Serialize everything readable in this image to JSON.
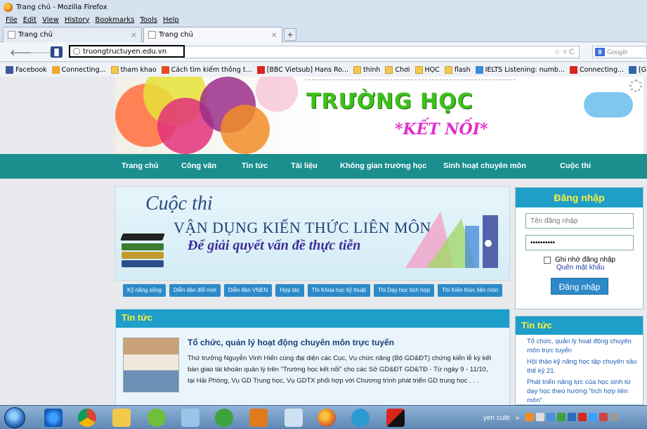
{
  "window": {
    "title": "Trang chủ - Mozilla Firefox"
  },
  "menu": [
    "File",
    "Edit",
    "View",
    "History",
    "Bookmarks",
    "Tools",
    "Help"
  ],
  "tabs": [
    {
      "label": "Trang chủ",
      "close": "×"
    },
    {
      "label": "Trang chủ",
      "close": "×"
    }
  ],
  "new_tab": "+",
  "nav": {
    "back": "🡐",
    "forward": "🡒",
    "url": "truongtructuyen.edu.vn",
    "search_placeholder": "Google",
    "search_engine": "8"
  },
  "bookmarks": [
    {
      "label": "Facebook",
      "icon": "facebook-icon"
    },
    {
      "label": "Connecting...",
      "icon": "connecting-icon"
    },
    {
      "label": "tham khao",
      "icon": "folder-icon"
    },
    {
      "label": "Cách tìm kiếm thông t...",
      "icon": "p-icon"
    },
    {
      "label": "[BBC Vietsub] Hans Ro...",
      "icon": "youtube-icon"
    },
    {
      "label": "thinh",
      "icon": "folder-icon"
    },
    {
      "label": "Chơi",
      "icon": "folder-icon"
    },
    {
      "label": "HỌC",
      "icon": "folder-icon"
    },
    {
      "label": "flash",
      "icon": "folder-icon"
    },
    {
      "label": "IELTS Listening: numb...",
      "icon": "ielts-icon"
    },
    {
      "label": "Connecting...",
      "icon": "youtube-icon"
    },
    {
      "label": "[Giải quyết] [Xóa",
      "icon": "globe-icon"
    }
  ],
  "banner": {
    "title": "TRƯỜNG HỌC",
    "subtitle": "*KẾT NỐI*"
  },
  "main_nav": [
    "Trang chủ",
    "Công văn",
    "Tin tức",
    "Tài liệu",
    "Không gian trường học",
    "Sinh hoạt chuyên môn",
    "Cuộc thi"
  ],
  "contest": {
    "title": "Cuộc thi",
    "line1": "VẬN DỤNG KIẾN THỨC LIÊN MÔN",
    "line2": "Để giải quyết vấn đề thực tiễn"
  },
  "categories": [
    "Kỹ năng sống",
    "Diễn đàn đổi mới",
    "Diễn đàn VNEN",
    "Hợp tác",
    "Thi Khoa học kỹ thuật",
    "Thi Dạy học tích hợp",
    "Thi Kiến thức liên môn"
  ],
  "news": {
    "header": "Tin tức",
    "title": "Tổ chức, quản lý hoạt động chuyên môn trực tuyến",
    "text": "Thứ trưởng Nguyễn Vinh Hiển cùng đại diện các Cục, Vụ chức năng (Bộ GD&ĐT) chứng kiến lễ ký kết bàn giao tài khoản quản lý trên \"Trường học kết nối\" cho các Sở GD&ĐT GD&TĐ - Từ ngày 9 - 11/10, tại Hải Phòng, Vụ GD Trung học, Vụ GDTX phối hợp với Chương trình phát triển GD trung học . . ."
  },
  "login": {
    "header": "Đăng nhập",
    "username_placeholder": "Tên đăng nhập",
    "password_value": "••••••••••",
    "remember": "Ghi nhớ đăng nhập",
    "forgot": "Quên mật khẩu",
    "button": "Đăng nhập"
  },
  "side_news": {
    "header": "Tin tức",
    "items": [
      "Tổ chức, quản lý hoạt động chuyên môn trực tuyến",
      "Hội thảo kỹ năng học tập chuyên sâu thế kỷ 21.",
      "Phát triển năng lực của học sinh từ dạy học theo hướng \"tích hợp liên môn\""
    ]
  },
  "taskbar": {
    "user": "yen cute",
    "chevron": "»"
  },
  "colors": {
    "teal_nav": "#1b8e8e",
    "blue_header": "#1e9ec9",
    "yellow_header_text": "#ffef3b",
    "green_banner": "#3ec01a",
    "magenta_banner": "#e02fcd"
  }
}
